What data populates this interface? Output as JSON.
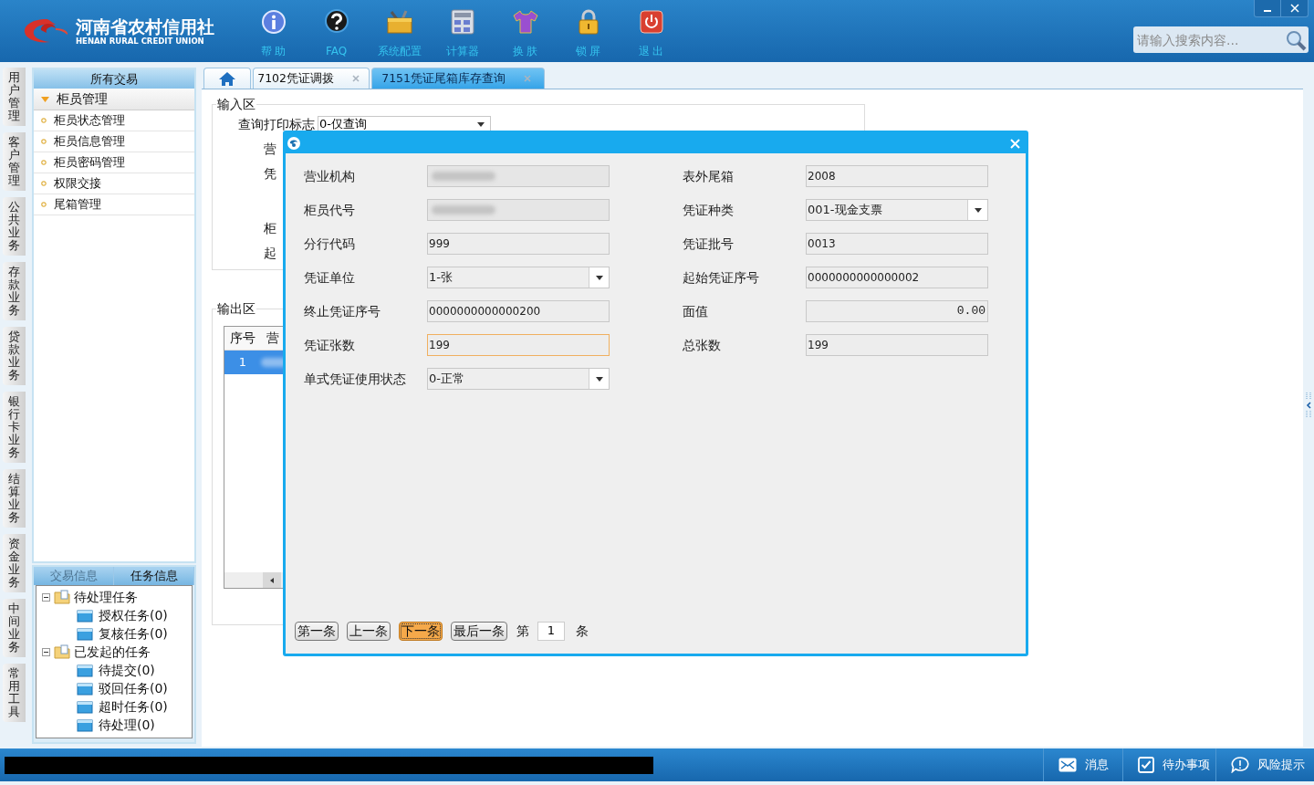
{
  "app": {
    "logo_cn": "河南省农村信用社",
    "logo_en": "HENAN RURAL CREDIT UNION"
  },
  "toolbar": [
    {
      "label": "帮 助",
      "kind": "info"
    },
    {
      "label": "FAQ",
      "kind": "faq"
    },
    {
      "label": "系统配置",
      "kind": "config"
    },
    {
      "label": "计算器",
      "kind": "calc"
    },
    {
      "label": "换 肤",
      "kind": "skin"
    },
    {
      "label": "锁 屏",
      "kind": "lock"
    },
    {
      "label": "退 出",
      "kind": "exit"
    }
  ],
  "search": {
    "placeholder": "请输入搜索内容..."
  },
  "side_tabs": [
    "用户管理",
    "客户管理",
    "公共业务",
    "存款业务",
    "贷款业务",
    "银行卡业务",
    "结算业务",
    "资金业务",
    "中间业务",
    "常用工具"
  ],
  "sidebar": {
    "title": "所有交易",
    "group": {
      "label": "柜员管理",
      "expanded": true,
      "items": [
        "柜员状态管理",
        "柜员信息管理",
        "柜员密码管理",
        "权限交接",
        "尾箱管理"
      ]
    }
  },
  "task_panel": {
    "tabs": [
      {
        "label": "交易信息",
        "selected": false
      },
      {
        "label": "任务信息",
        "selected": true
      }
    ],
    "tree": [
      {
        "label": "待处理任务",
        "expanded": true,
        "children": [
          {
            "label": "授权任务(0)"
          },
          {
            "label": "复核任务(0)"
          }
        ]
      },
      {
        "label": "已发起的任务",
        "expanded": true,
        "children": [
          {
            "label": "待提交(0)"
          },
          {
            "label": "驳回任务(0)"
          },
          {
            "label": "超时任务(0)"
          },
          {
            "label": "待处理(0)"
          }
        ]
      }
    ]
  },
  "tabs": [
    {
      "kind": "home",
      "selected": false
    },
    {
      "kind": "page",
      "label": "7102凭证调拨",
      "selected": false
    },
    {
      "kind": "page",
      "label": "7151凭证尾箱库存查询",
      "selected": true
    }
  ],
  "input_area": {
    "legend": "输入区",
    "rows": [
      {
        "kind": "select",
        "label": "查询打印标志",
        "value": "0-仅查询"
      },
      {
        "kind": "label",
        "label": "营"
      },
      {
        "kind": "label",
        "label": "凭"
      },
      {
        "kind": "label",
        "label": "柜"
      },
      {
        "kind": "label",
        "label": "起"
      }
    ]
  },
  "output_area": {
    "legend": "输出区",
    "columns": [
      "序号",
      "营"
    ],
    "rows": [
      {
        "index": "1",
        "selected": true
      }
    ]
  },
  "dialog": {
    "fields_left": [
      {
        "label": "营业机构",
        "kind": "blurred",
        "focused": false
      },
      {
        "label": "柜员代号",
        "kind": "blurred",
        "focused": false
      },
      {
        "label": "分行代码",
        "kind": "text",
        "value": "999",
        "focused": false
      },
      {
        "label": "凭证单位",
        "kind": "select",
        "value": "1-张",
        "focused": false
      },
      {
        "label": "终止凭证序号",
        "kind": "text",
        "value": "0000000000000200",
        "focused": false
      },
      {
        "label": "凭证张数",
        "kind": "text",
        "value": "199",
        "focused": true
      },
      {
        "label": "单式凭证使用状态",
        "kind": "select",
        "value": "0-正常",
        "focused": false
      }
    ],
    "fields_right": [
      {
        "label": "表外尾箱",
        "kind": "text",
        "value": "2008",
        "focused": false
      },
      {
        "label": "凭证种类",
        "kind": "select",
        "value": "001-现金支票",
        "focused": false
      },
      {
        "label": "凭证批号",
        "kind": "text",
        "value": "0013",
        "focused": false
      },
      {
        "label": "起始凭证序号",
        "kind": "text",
        "value": "0000000000000002",
        "focused": false
      },
      {
        "label": "面值",
        "kind": "amount",
        "value": "0.00",
        "focused": false
      },
      {
        "label": "总张数",
        "kind": "text",
        "value": "199",
        "focused": false
      }
    ],
    "pager": {
      "buttons": [
        {
          "label": "第一条",
          "selected": false
        },
        {
          "label": "上一条",
          "selected": false
        },
        {
          "label": "下一条",
          "selected": true
        },
        {
          "label": "最后一条",
          "selected": false
        }
      ],
      "prefix": "第",
      "page": "1",
      "suffix": "条"
    }
  },
  "status_bar": {
    "items": [
      {
        "kind": "message",
        "label": "消息"
      },
      {
        "kind": "todo",
        "label": "待办事项"
      },
      {
        "kind": "risk",
        "label": "风险提示"
      }
    ]
  }
}
